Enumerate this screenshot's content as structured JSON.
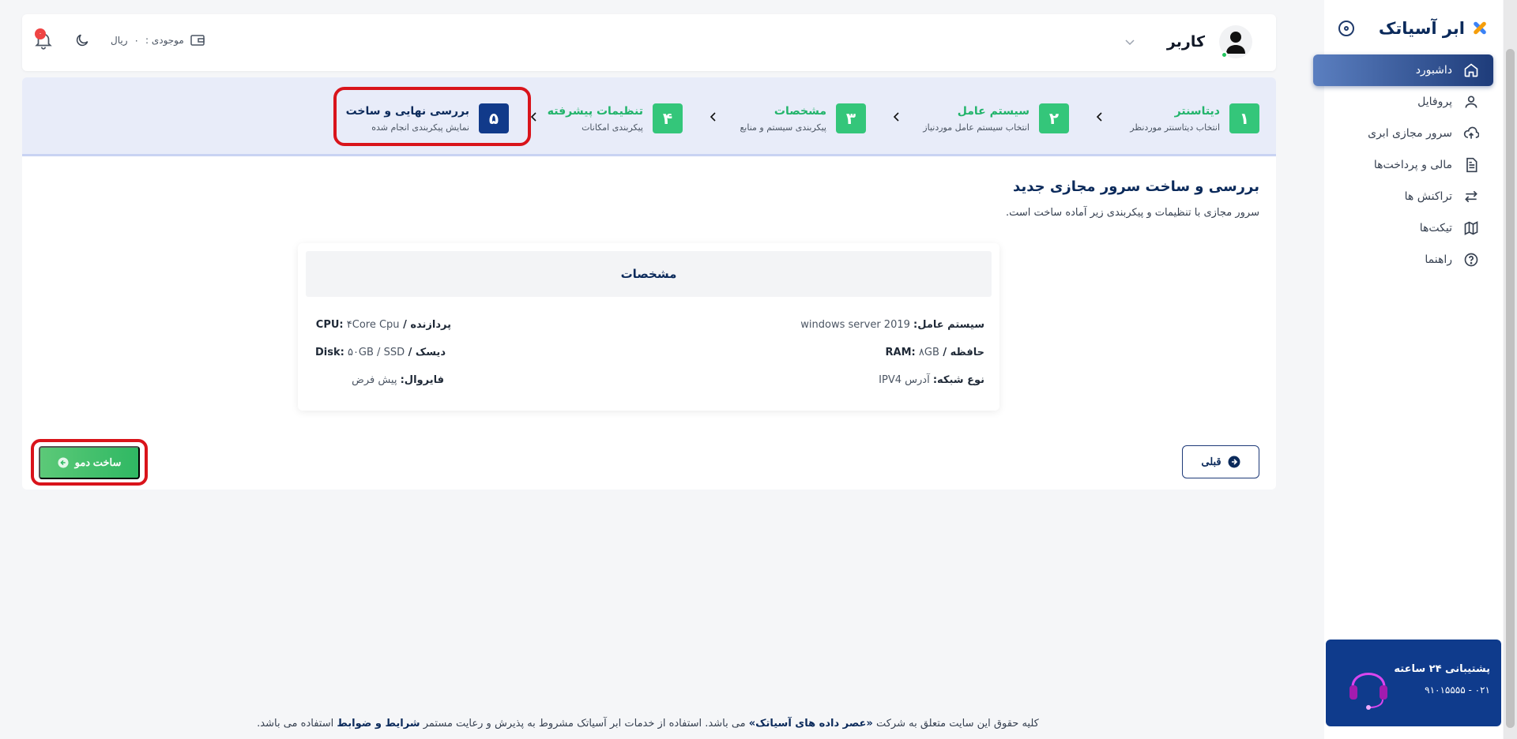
{
  "brand": {
    "name": "ابر آسیاتک"
  },
  "nav": [
    {
      "label": "داشبورد",
      "icon": "home-icon",
      "active": true
    },
    {
      "label": "پروفایل",
      "icon": "user-icon"
    },
    {
      "label": "سرور مجازی ابری",
      "icon": "cloud-upload-icon"
    },
    {
      "label": "مالی و پرداخت‌ها",
      "icon": "document-icon"
    },
    {
      "label": "تراکنش ها",
      "icon": "transfer-icon"
    },
    {
      "label": "تیکت‌ها",
      "icon": "map-icon"
    },
    {
      "label": "راهنما",
      "icon": "help-icon"
    }
  ],
  "support": {
    "title": "پشتیبانی ۲۴ ساعته",
    "phone": "۰۲۱ - ۹۱۰۱۵۵۵۵"
  },
  "header": {
    "user_name": "کاربر",
    "balance_label": "موجودی :",
    "balance_value": "۰",
    "balance_unit": "ریال",
    "notification_count": "۰"
  },
  "steps": [
    {
      "num": "۱",
      "title": "دیتاسنتر",
      "sub": "انتخاب دیتاسنتر موردنظر"
    },
    {
      "num": "۲",
      "title": "سیستم عامل",
      "sub": "انتخاب سیستم عامل موردنیاز"
    },
    {
      "num": "۳",
      "title": "مشخصات",
      "sub": "پیکربندی سیستم و منابع"
    },
    {
      "num": "۴",
      "title": "تنظیمات پیشرفته",
      "sub": "پیکربندی امکانات"
    },
    {
      "num": "۵",
      "title": "بررسی نهایی و ساخت",
      "sub": "نمایش پیکربندی انجام شده"
    }
  ],
  "content": {
    "title": "بررسی و ساخت سرور مجازی جدید",
    "subtitle": "سرور مجازی با تنظیمات و پیکربندی زیر آماده ساخت است."
  },
  "specs": {
    "header": "مشخصات",
    "os_label": "سیستم عامل:",
    "os_value": "windows server 2019",
    "ram_label": "حافظه / RAM:",
    "ram_value": "۸GB",
    "net_label": "نوع شبکه:",
    "net_value": "آدرس IPV4",
    "cpu_label": "پردازنده / CPU:",
    "cpu_value": "۴Core Cpu",
    "disk_label": "دیسک / Disk:",
    "disk_value": "۵۰GB / SSD",
    "fw_label": "فایروال:",
    "fw_value": "پیش فرض"
  },
  "buttons": {
    "prev": "قبلی",
    "create": "ساخت دمو"
  },
  "footer": {
    "part1": "کلیه حقوق این سایت متعلق به شرکت",
    "company": "«عصر داده های آسیاتک»",
    "part2": "می باشد. استفاده از خدمات ابر آسیاتک مشروط به پذیرش و رعایت مستمر",
    "terms": "شرایط و ضوابط",
    "part3": "استفاده می باشد."
  }
}
